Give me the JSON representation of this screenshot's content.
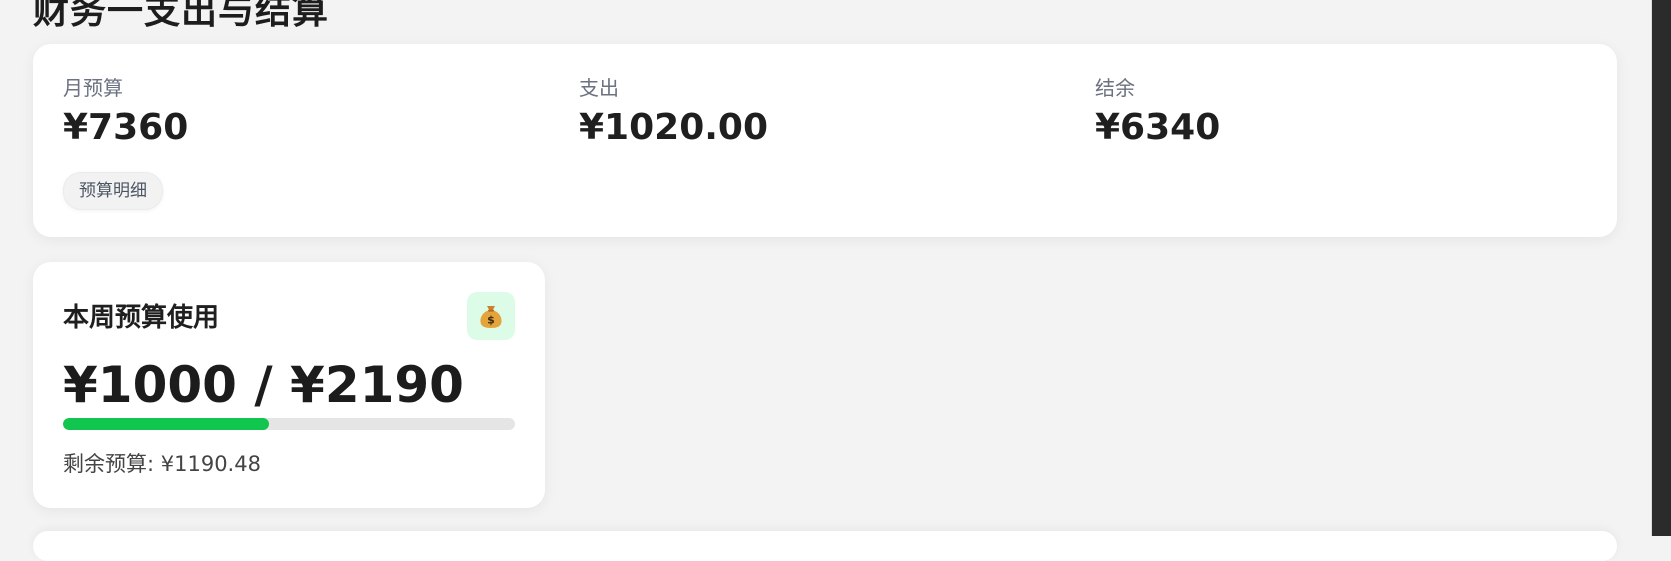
{
  "page": {
    "title": "财务一支出与结算"
  },
  "summary": {
    "monthly_budget_label": "月预算",
    "monthly_budget_value": "¥7360",
    "expense_label": "支出",
    "expense_value": "¥1020.00",
    "balance_label": "结余",
    "balance_value": "¥6340",
    "detail_button_label": "预算明细"
  },
  "weekly": {
    "title": "本周预算使用",
    "icon": "money-bag-icon",
    "used_value": "¥1000 / ¥2190",
    "remaining_text": "剩余预算: ¥1190.48",
    "progress_fraction": 0.456,
    "progress_color": "#10c64f"
  },
  "theme": {
    "background": "#f3f3f3",
    "card_background": "#ffffff",
    "icon_tile_background": "#dcfce7"
  }
}
